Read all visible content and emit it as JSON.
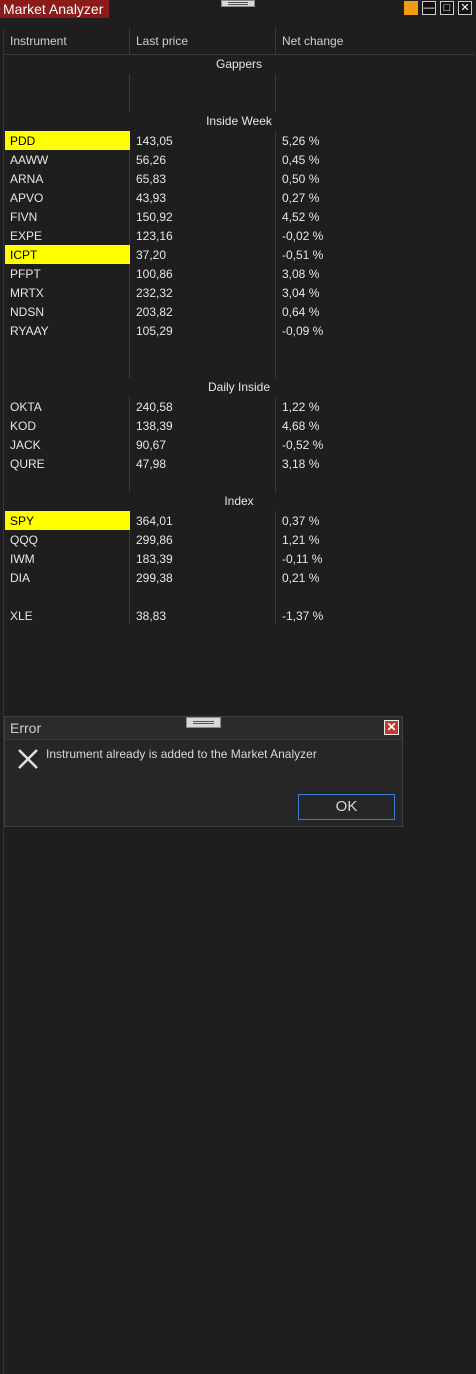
{
  "window": {
    "title": "Market Analyzer",
    "min_symbol": "—",
    "max_symbol": "□",
    "close_symbol": "✕"
  },
  "columns": {
    "instrument": "Instrument",
    "last_price": "Last price",
    "net_change": "Net change"
  },
  "groups": {
    "gappers": {
      "label": "Gappers"
    },
    "inside_week": {
      "label": "Inside Week",
      "rows": [
        {
          "instrument": "PDD",
          "last": "143,05",
          "change": "5,26 %"
        },
        {
          "instrument": "AAWW",
          "last": "56,26",
          "change": "0,45 %"
        },
        {
          "instrument": "ARNA",
          "last": "65,83",
          "change": "0,50 %"
        },
        {
          "instrument": "APVO",
          "last": "43,93",
          "change": "0,27 %"
        },
        {
          "instrument": "FIVN",
          "last": "150,92",
          "change": "4,52 %"
        },
        {
          "instrument": "EXPE",
          "last": "123,16",
          "change": "-0,02 %"
        },
        {
          "instrument": "ICPT",
          "last": "37,20",
          "change": "-0,51 %"
        },
        {
          "instrument": "PFPT",
          "last": "100,86",
          "change": "3,08 %"
        },
        {
          "instrument": "MRTX",
          "last": "232,32",
          "change": "3,04 %"
        },
        {
          "instrument": "NDSN",
          "last": "203,82",
          "change": "0,64 %"
        },
        {
          "instrument": "RYAAY",
          "last": "105,29",
          "change": "-0,09 %"
        }
      ]
    },
    "daily_inside": {
      "label": "Daily Inside",
      "rows": [
        {
          "instrument": "OKTA",
          "last": "240,58",
          "change": "1,22 %"
        },
        {
          "instrument": "KOD",
          "last": "138,39",
          "change": "4,68 %"
        },
        {
          "instrument": "JACK",
          "last": "90,67",
          "change": "-0,52 %"
        },
        {
          "instrument": "QURE",
          "last": "47,98",
          "change": "3,18 %"
        }
      ]
    },
    "index": {
      "label": "Index",
      "rows": [
        {
          "instrument": "SPY",
          "last": "364,01",
          "change": "0,37 %"
        },
        {
          "instrument": "QQQ",
          "last": "299,86",
          "change": "1,21 %"
        },
        {
          "instrument": "IWM",
          "last": "183,39",
          "change": "-0,11 %"
        },
        {
          "instrument": "DIA",
          "last": "299,38",
          "change": "0,21 %"
        },
        {
          "instrument": "XLE",
          "last": "38,83",
          "change": "-1,37 %"
        }
      ]
    }
  },
  "dialog": {
    "title": "Error",
    "message": "Instrument already is added to the Market Analyzer",
    "ok_label": "OK",
    "close_symbol": "✕",
    "icon": "error-x-icon"
  },
  "colors": {
    "background": "#1e1e1e",
    "highlight": "#ffff00",
    "title_tab": "#8b1a1a",
    "ok_border": "#3d7bd8",
    "dialog_close": "#c0392b"
  }
}
